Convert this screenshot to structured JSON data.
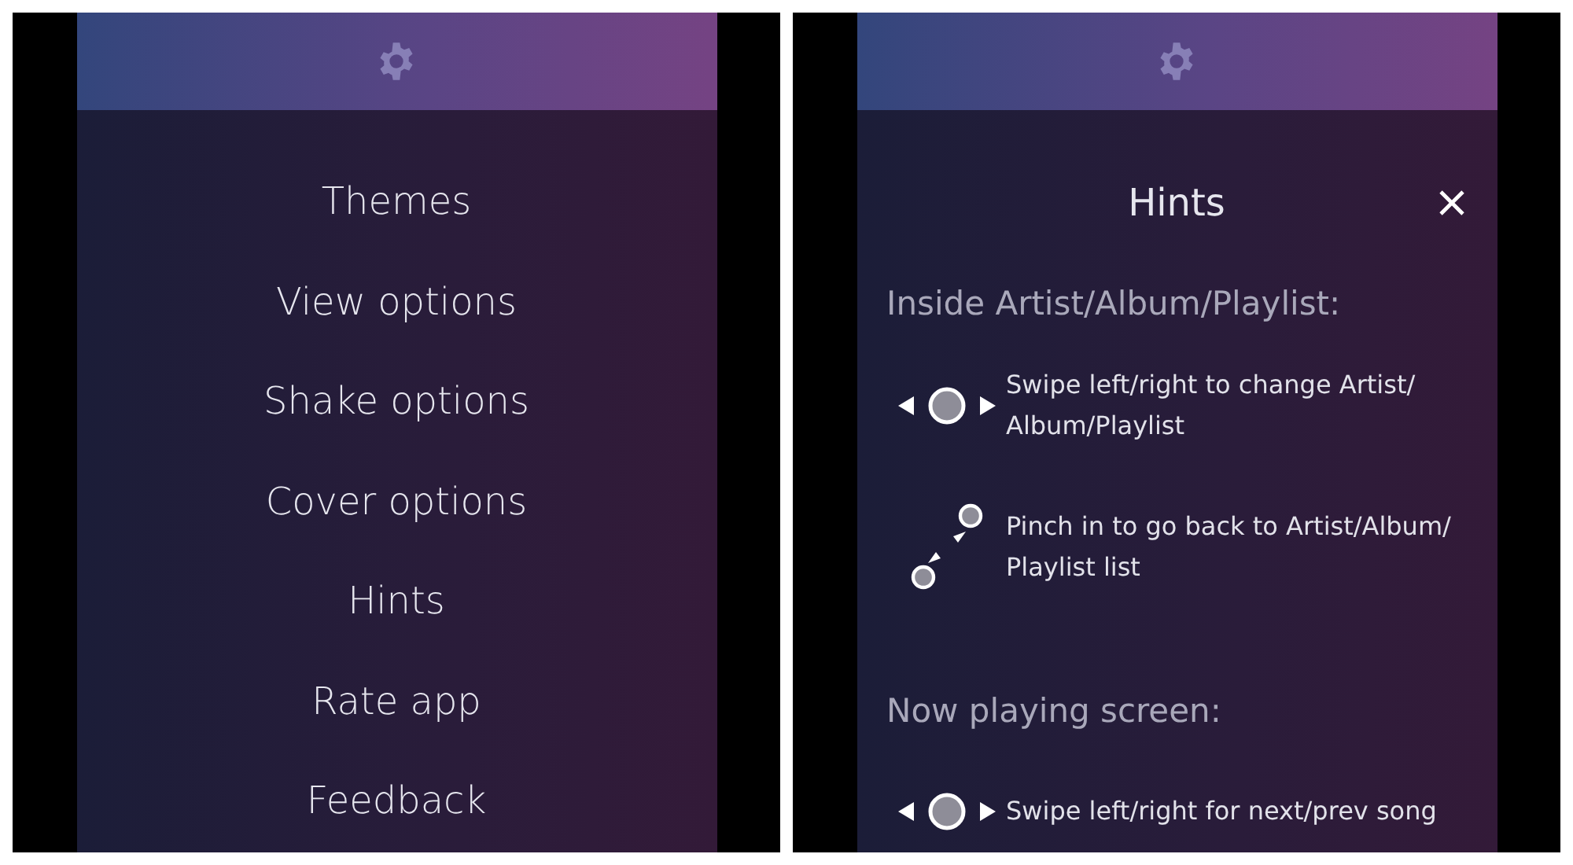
{
  "settings_screen": {
    "menu": [
      {
        "label": "Themes"
      },
      {
        "label": "View options"
      },
      {
        "label": "Shake options"
      },
      {
        "label": "Cover options"
      },
      {
        "label": "Hints"
      },
      {
        "label": "Rate app"
      },
      {
        "label": "Feedback"
      }
    ]
  },
  "hints_screen": {
    "title": "Hints",
    "sections": [
      {
        "heading": "Inside Artist/Album/Playlist:",
        "hints": [
          {
            "kind": "swipe",
            "text": "Swipe left/right to change Artist/ Album/Playlist"
          },
          {
            "kind": "pinch",
            "text": "Pinch in to go back to Artist/Album/ Playlist list"
          }
        ]
      },
      {
        "heading": "Now playing screen:",
        "hints": [
          {
            "kind": "swipe",
            "text": "Swipe left/right for next/prev song"
          }
        ]
      }
    ]
  }
}
